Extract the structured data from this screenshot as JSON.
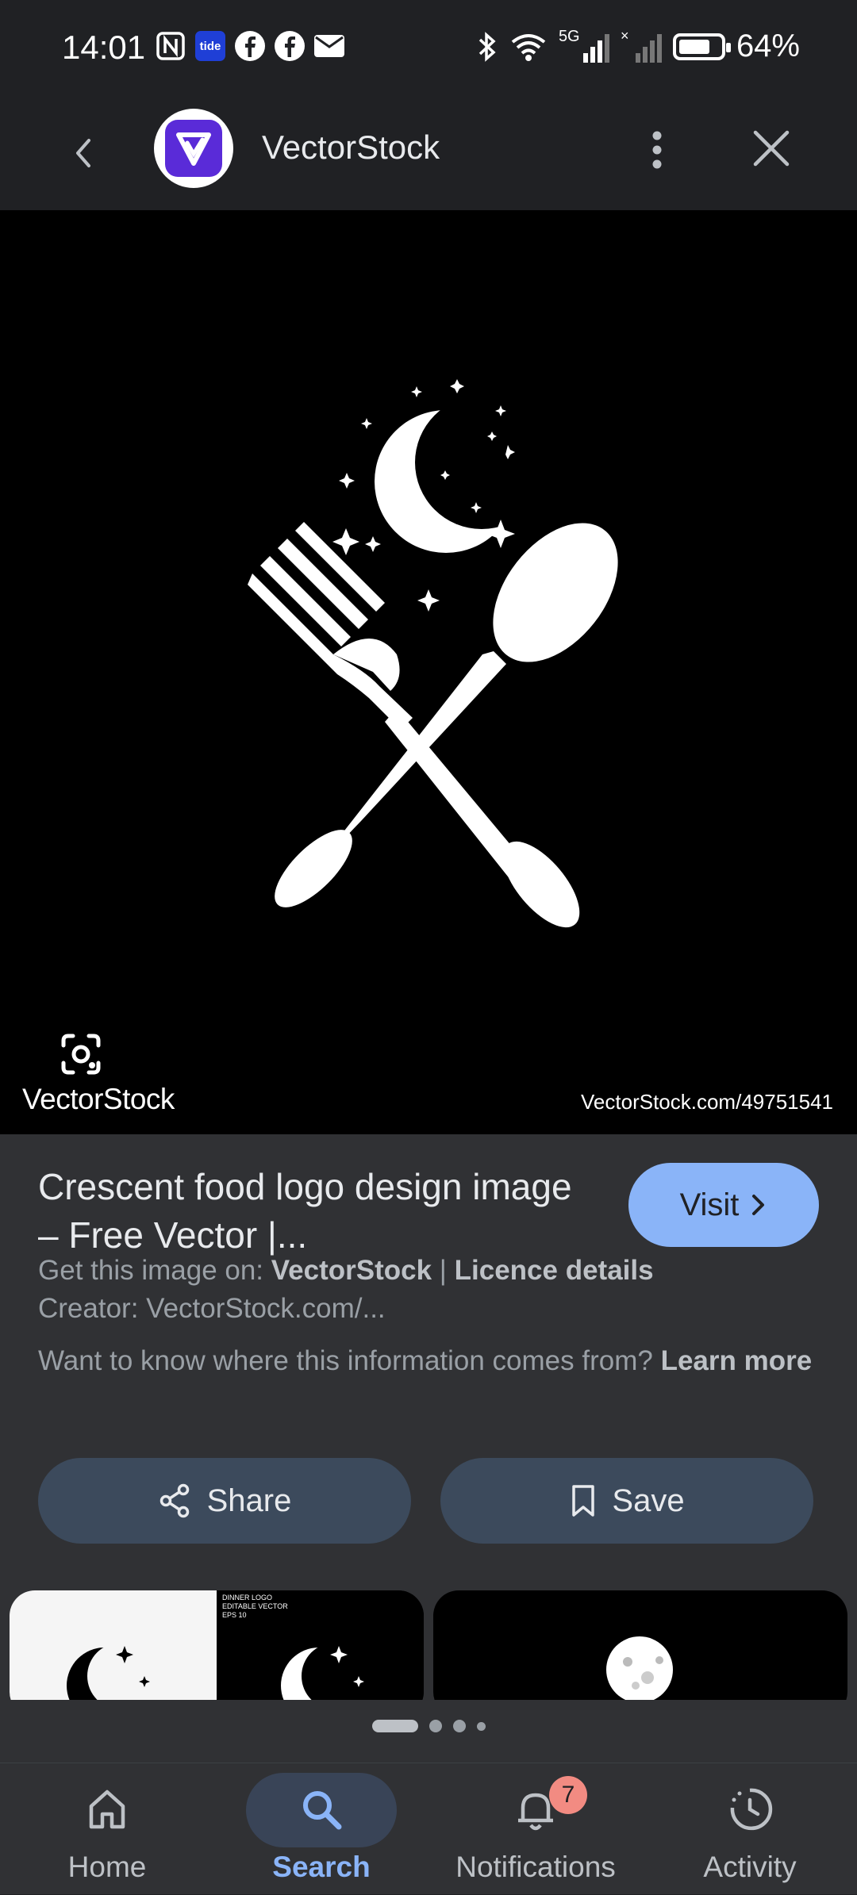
{
  "status_bar": {
    "time": "14:01",
    "battery": "64%",
    "network": "5G",
    "left_icons": [
      "nfc-icon",
      "tide-icon",
      "facebook-icon",
      "facebook-icon",
      "mail-icon"
    ],
    "tide_label": "tide"
  },
  "header": {
    "site_name": "VectorStock",
    "logo_icon": "vectorstock-logo-icon"
  },
  "image": {
    "watermark_left": "VectorStock",
    "watermark_right": "VectorStock.com/49751541",
    "description_icons": [
      "crescent-moon-icon",
      "fork-icon",
      "spoon-icon",
      "stars-icon"
    ]
  },
  "result": {
    "title": "Crescent food logo design image – Free Vector |...",
    "visit_label": "Visit",
    "source_prefix": "Get this image on: ",
    "source_name": "VectorStock",
    "source_sep": " | ",
    "licence_label": "Licence details",
    "creator": "Creator: VectorStock.com/...",
    "know_text": "Want to know where this information comes from? ",
    "learn_more": "Learn more"
  },
  "actions": {
    "share_label": "Share",
    "save_label": "Save"
  },
  "thumbnails": {
    "thumb1_caption": "DINNER LOGO",
    "thumb1_sub": "EDITABLE VECTOR",
    "thumb1_eps": "EPS 10"
  },
  "bottom_nav": {
    "items": [
      {
        "label": "Home",
        "icon": "home-icon"
      },
      {
        "label": "Search",
        "icon": "search-icon"
      },
      {
        "label": "Notifications",
        "icon": "bell-icon"
      },
      {
        "label": "Activity",
        "icon": "activity-icon"
      }
    ],
    "notification_count": "7"
  },
  "colors": {
    "accent": "#8ab4f8",
    "brand": "#5a2bd8",
    "badge": "#f28b82"
  }
}
